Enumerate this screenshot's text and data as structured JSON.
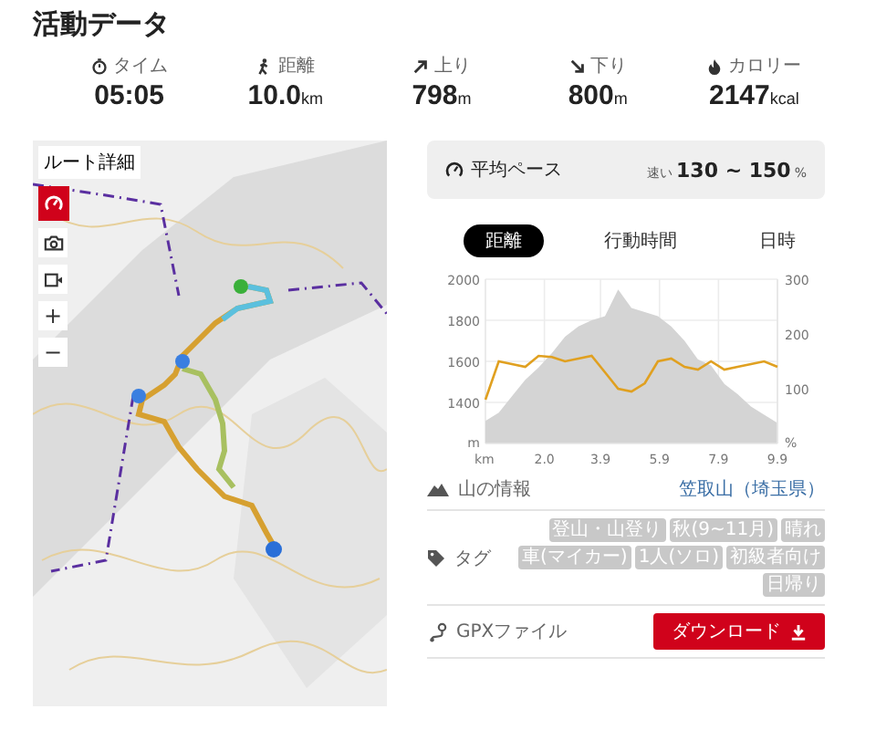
{
  "title": "活動データ",
  "stats": [
    {
      "kind": "time",
      "label": "タイム",
      "value": "05:05"
    },
    {
      "kind": "distance",
      "label": "距離",
      "value": "10.0",
      "unit": "km"
    },
    {
      "kind": "ascent",
      "label": "上り",
      "value": "798",
      "unit": "m"
    },
    {
      "kind": "descent",
      "label": "下り",
      "value": "800",
      "unit": "m"
    },
    {
      "kind": "calorie",
      "label": "カロリー",
      "value": "2147",
      "unit": "kcal"
    }
  ],
  "map": {
    "kind": "picture",
    "route_detail_button": "ルート詳細",
    "zoom_in": "+",
    "zoom_out": "−"
  },
  "pace": {
    "label": "平均ペース",
    "qualifier": "速い",
    "value": "130 ~ 150",
    "unit": "%"
  },
  "chart_tabs": [
    {
      "label": "距離",
      "selected": true
    },
    {
      "label": "行動時間",
      "selected": false
    },
    {
      "label": "日時",
      "selected": false
    }
  ],
  "chart": {
    "y_unit": "m",
    "x_unit": "km",
    "chart_data": {
      "type": "area",
      "grid": true,
      "x": [
        0,
        0.45,
        0.9,
        1.35,
        1.8,
        2.25,
        2.7,
        3.15,
        3.6,
        4.05,
        4.5,
        4.95,
        5.4,
        5.85,
        6.3,
        6.75,
        7.2,
        7.65,
        8.1,
        8.55,
        9.0,
        9.45,
        9.9
      ],
      "series": [
        {
          "color": "#d4d4d4",
          "values": [
            1310,
            1350,
            1430,
            1510,
            1570,
            1640,
            1720,
            1770,
            1800,
            1820,
            1950,
            1860,
            1840,
            1820,
            1770,
            1700,
            1610,
            1580,
            1490,
            1440,
            1380,
            1340,
            1300
          ]
        }
      ],
      "ylim": [
        1200,
        2000
      ],
      "yticks": [
        1400,
        1600,
        1800,
        2000
      ],
      "xlim": [
        0,
        9.9
      ],
      "xticks": [
        {
          "value": 2.0,
          "label": "2.0"
        },
        {
          "value": 3.9,
          "label": "3.9"
        },
        {
          "value": 5.9,
          "label": "5.9"
        },
        {
          "value": 7.9,
          "label": "7.9"
        },
        {
          "value": 9.9,
          "label": "9.9"
        }
      ]
    }
  },
  "pace_chart": {
    "unit": "%",
    "chart_data": {
      "type": "line",
      "series": [
        {
          "color": "#e0a020",
          "values": [
            80,
            150,
            145,
            140,
            160,
            158,
            150,
            155,
            160,
            130,
            100,
            95,
            110,
            150,
            155,
            140,
            135,
            150,
            135,
            140,
            145,
            150,
            140
          ]
        }
      ],
      "ylim": [
        0,
        300
      ],
      "yticks": [
        100,
        200,
        300
      ]
    }
  },
  "mountain": {
    "label": "山の情報",
    "value": "笠取山（埼玉県）"
  },
  "tags": {
    "label": "タグ",
    "items": [
      "登山・山登り",
      "秋(9~11月)",
      "晴れ",
      "車(マイカー)",
      "1人(ソロ)",
      "初級者向け",
      "日帰り"
    ]
  },
  "gpx": {
    "label": "GPXファイル",
    "button": "ダウンロード"
  }
}
